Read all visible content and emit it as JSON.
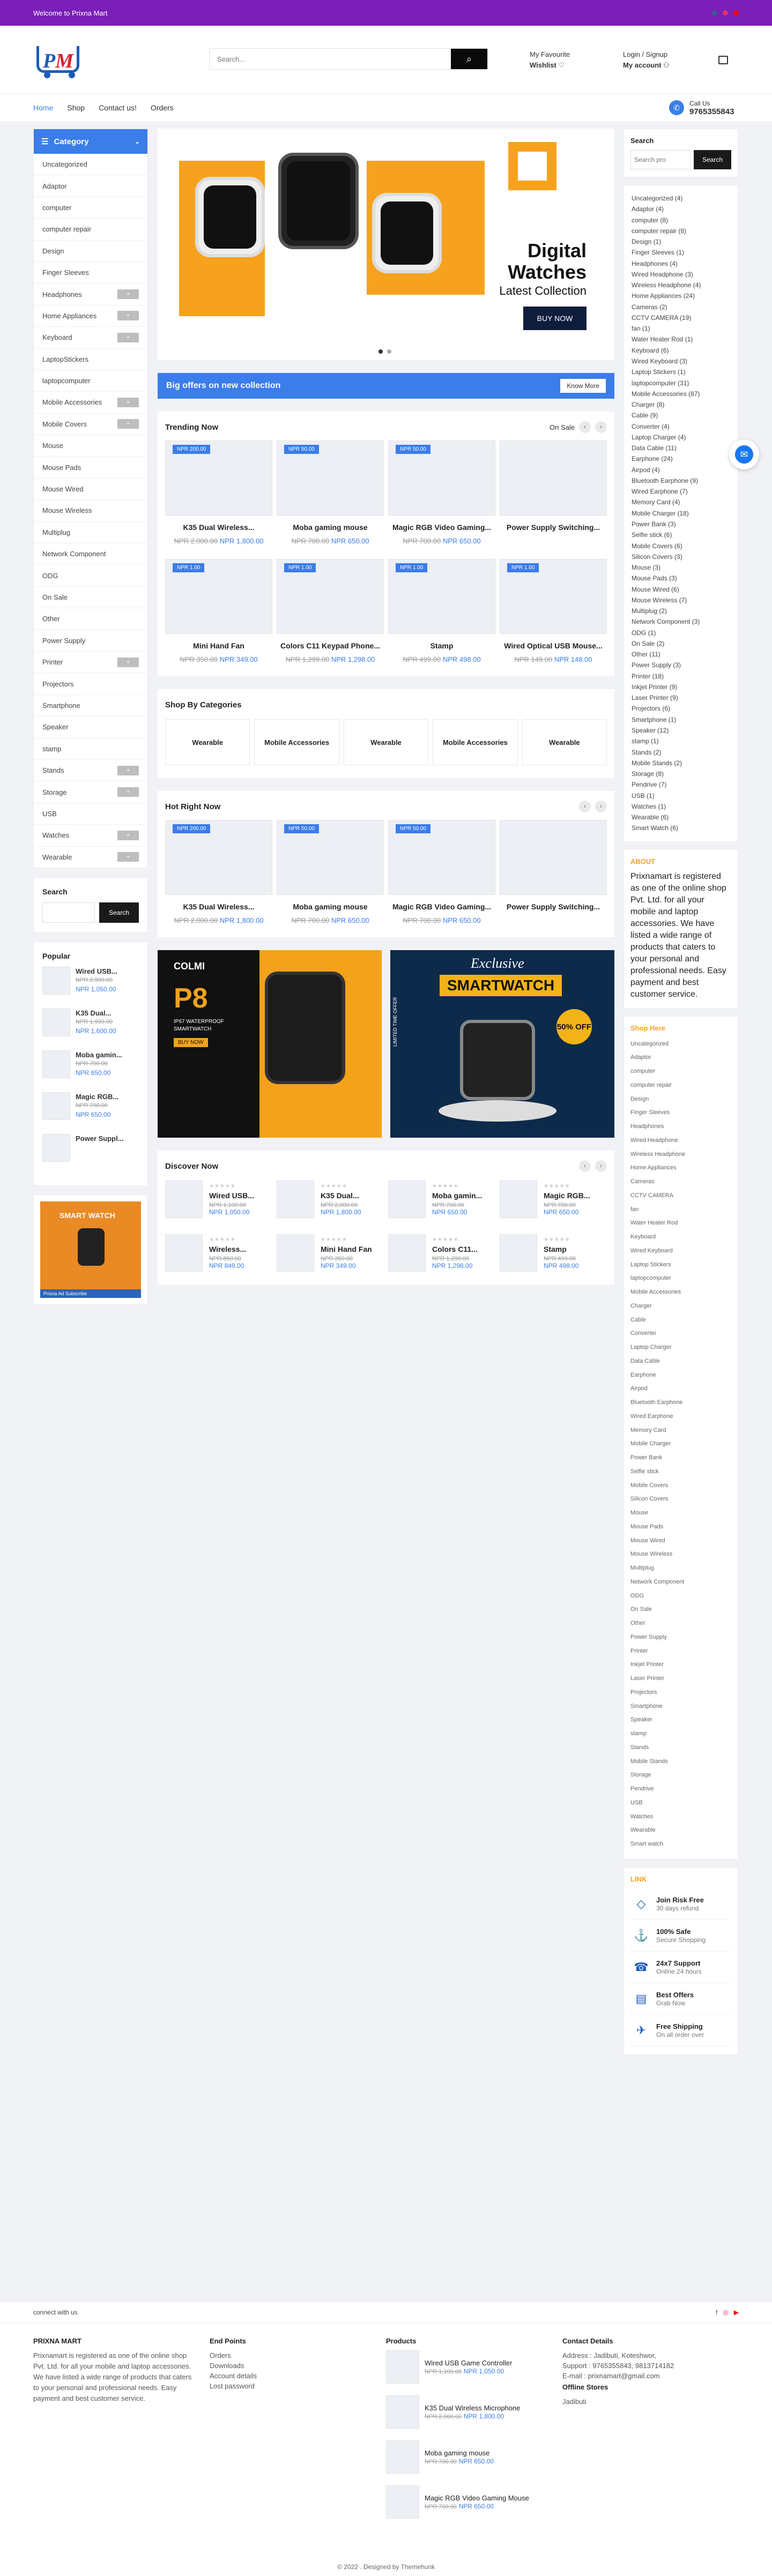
{
  "topbar": {
    "welcome": "Welcome to Prixna Mart",
    "social": [
      "#3b5998",
      "#e1306c",
      "#ff0000"
    ]
  },
  "header": {
    "logo": "PM",
    "search_placeholder": "Search...",
    "favourite_label": "My Favourite",
    "wishlist_label": "Wishlist",
    "login_label": "Login / Signup",
    "account_label": "My account"
  },
  "nav": {
    "links": [
      "Home",
      "Shop",
      "Contact us!",
      "Orders"
    ],
    "call_label": "Call Us",
    "phone": "9765355843"
  },
  "sidebar": {
    "title": "Category",
    "categories": [
      {
        "label": "Uncategorized",
        "expand": false
      },
      {
        "label": "Adaptor",
        "expand": false
      },
      {
        "label": "computer",
        "expand": false
      },
      {
        "label": "computer repair",
        "expand": false
      },
      {
        "label": "Design",
        "expand": false
      },
      {
        "label": "Finger Sleeves",
        "expand": false
      },
      {
        "label": "Headphones",
        "expand": true
      },
      {
        "label": "Home Appliances",
        "expand": true
      },
      {
        "label": "Keyboard",
        "expand": true
      },
      {
        "label": "LaptopStickers",
        "expand": false
      },
      {
        "label": "laptopcomputer",
        "expand": false
      },
      {
        "label": "Mobile Accessories",
        "expand": true
      },
      {
        "label": "Mobile Covers",
        "expand": true
      },
      {
        "label": "Mouse",
        "expand": false
      },
      {
        "label": "Mouse Pads",
        "expand": false
      },
      {
        "label": "Mouse Wired",
        "expand": false
      },
      {
        "label": "Mouse Wireless",
        "expand": false
      },
      {
        "label": "Multiplug",
        "expand": false
      },
      {
        "label": "Network Component",
        "expand": false
      },
      {
        "label": "ODG",
        "expand": false
      },
      {
        "label": "On Sale",
        "expand": false
      },
      {
        "label": "Other",
        "expand": false
      },
      {
        "label": "Power Supply",
        "expand": false
      },
      {
        "label": "Printer",
        "expand": true
      },
      {
        "label": "Projectors",
        "expand": false
      },
      {
        "label": "Smartphone",
        "expand": false
      },
      {
        "label": "Speaker",
        "expand": false
      },
      {
        "label": "stamp",
        "expand": false
      },
      {
        "label": "Stands",
        "expand": true
      },
      {
        "label": "Storage",
        "expand": true
      },
      {
        "label": "USB",
        "expand": false
      },
      {
        "label": "Watches",
        "expand": true
      },
      {
        "label": "Wearable",
        "expand": true
      }
    ],
    "expand_symbol": "+",
    "search_title": "Search",
    "search_button": "Search",
    "popular_title": "Popular",
    "popular": [
      {
        "name": "Wired USB...",
        "old": "NPR 2,999.00",
        "new": "NPR 1,050.00"
      },
      {
        "name": "K35 Dual...",
        "old": "NPR 1,999.00",
        "new": "NPR 1,600.00"
      },
      {
        "name": "Moba gamin...",
        "old": "NPR 790.00",
        "new": "NPR 650.00"
      },
      {
        "name": "Magic RGB...",
        "old": "NPR 790.00",
        "new": "NPR 650.00"
      },
      {
        "name": "Power Suppl...",
        "old": "",
        "new": ""
      }
    ],
    "promo_caption": "Prixna Ad Subscribe"
  },
  "hero": {
    "title_line1": "Digital",
    "title_line2": "Watches",
    "subtitle": "Latest Collection",
    "button": "BUY NOW"
  },
  "offer": {
    "text": "Big offers on new collection",
    "button": "Know More"
  },
  "trending": {
    "title": "Trending Now",
    "onsale": "On Sale",
    "products": [
      {
        "tag": "NPR 200.00",
        "name": "K35 Dual Wireless...",
        "old": "NPR 2,000.00",
        "new": "NPR 1,800.00"
      },
      {
        "tag": "NPR 50.00",
        "name": "Moba gaming mouse",
        "old": "NPR 700.00",
        "new": "NPR 650.00"
      },
      {
        "tag": "NPR 50.00",
        "name": "Magic RGB Video Gaming...",
        "old": "NPR 700.00",
        "new": "NPR 650.00"
      },
      {
        "tag": "",
        "name": "Power Supply Switching...",
        "old": "",
        "new": ""
      },
      {
        "tag": "NPR 1.00",
        "name": "Mini Hand Fan",
        "old": "NPR 350.00",
        "new": "NPR 349.00"
      },
      {
        "tag": "NPR 1.00",
        "name": "Colors C11 Keypad Phone...",
        "old": "NPR 1,299.00",
        "new": "NPR 1,298.00"
      },
      {
        "tag": "NPR 1.00",
        "name": "Stamp",
        "old": "NPR 499.00",
        "new": "NPR 498.00"
      },
      {
        "tag": "NPR 1.00",
        "name": "Wired Optical USB Mouse...",
        "old": "NPR 149.00",
        "new": "NPR 148.00"
      }
    ]
  },
  "categories": {
    "title": "Shop By Categories",
    "items": [
      "Wearable",
      "Mobile Accessories",
      "Wearable",
      "Mobile Accessories",
      "Wearable"
    ]
  },
  "hotright": {
    "title": "Hot Right Now",
    "products": [
      {
        "tag": "NPR 200.00",
        "name": "K35 Dual Wireless...",
        "old": "NPR 2,000.00",
        "new": "NPR 1,800.00"
      },
      {
        "tag": "NPR 50.00",
        "name": "Moba gaming mouse",
        "old": "NPR 700.00",
        "new": "NPR 650.00"
      },
      {
        "tag": "NPR 50.00",
        "name": "Magic RGB Video Gaming...",
        "old": "NPR 700.00",
        "new": "NPR 650.00"
      },
      {
        "tag": "",
        "name": "Power Supply Switching...",
        "old": "",
        "new": ""
      }
    ]
  },
  "banners": {
    "b1_brand": "COLMI",
    "b1_model": "P8",
    "b1_spec1": "IP67 WATERPROOF",
    "b1_spec2": "SMARTWATCH",
    "b1_badge": "BUY NOW",
    "b2_top": "Exclusive",
    "b2_title": "SMARTWATCH",
    "b2_badge": "50% OFF",
    "b2_side": "LIMITED TIME OFFER"
  },
  "discover": {
    "title": "Discover Now",
    "stars": "★★★★★",
    "items": [
      {
        "name": "Wired USB...",
        "old": "NPR 1,100.00",
        "new": "NPR 1,050.00"
      },
      {
        "name": "K35 Dual...",
        "old": "NPR 2,000.00",
        "new": "NPR 1,800.00"
      },
      {
        "name": "Moba gamin...",
        "old": "NPR 700.00",
        "new": "NPR 650.00"
      },
      {
        "name": "Magic RGB...",
        "old": "NPR 700.00",
        "new": "NPR 650.00"
      },
      {
        "name": "Wireless...",
        "old": "NPR 850.00",
        "new": "NPR 849.00"
      },
      {
        "name": "Mini Hand Fan",
        "old": "NPR 350.00",
        "new": "NPR 349.00"
      },
      {
        "name": "Colors C11...",
        "old": "NPR 1,299.00",
        "new": "NPR 1,298.00"
      },
      {
        "name": "Stamp",
        "old": "NPR 499.00",
        "new": "NPR 498.00"
      }
    ]
  },
  "right": {
    "search_title": "Search",
    "search_placeholder": "Search pro",
    "search_button": "Search",
    "cat_counts": [
      "Uncategorized (4)",
      "Adaptor (4)",
      "computer (8)",
      "computer repair (8)",
      "Design (1)",
      "Finger Sleeves (1)",
      "Headphones (4)",
      "Wired Headphone (3)",
      "Wireless Headphone (4)",
      "Home Appliances (24)",
      "Cameras (2)",
      "CCTV CAMERA (19)",
      "fan (1)",
      "Water Heater Rod (1)",
      "Keyboard (6)",
      "Wired Keyboard (3)",
      "Laptop Stickers (1)",
      "laptopcomputer (31)",
      "Mobile Accessories (87)",
      "Charger (8)",
      "Cable (9)",
      "Converter (4)",
      "Laptop Charger (4)",
      "Data Cable (11)",
      "Earphone (24)",
      "Airpod (4)",
      "Bluetooth Earphone (9)",
      "Wired Earphone (7)",
      "Memory Card (4)",
      "Mobile Charger (18)",
      "Power Bank (3)",
      "Selfie stick (6)",
      "Mobile Covers (6)",
      "Silicon Covers (3)",
      "Mouse (3)",
      "Mouse Pads (3)",
      "Mouse Wired (6)",
      "Mouse Wireless (7)",
      "Multiplug (2)",
      "Network Component (3)",
      "ODG (1)",
      "On Sale (2)",
      "Other (11)",
      "Power Supply (3)",
      "Printer (18)",
      "Inkjet Printer (9)",
      "Laser Printer (9)",
      "Projectors (6)",
      "Smartphone (1)",
      "Speaker (12)",
      "stamp (1)",
      "Stands (2)",
      "Mobile Stands (2)",
      "Storage (8)",
      "Pendrive (7)",
      "USB (1)",
      "Watches (1)",
      "Wearable (6)",
      "Smart Watch (6)"
    ],
    "about_title": "ABOUT",
    "about_text": "Prixnamart is registered as one of the online shop Pvt. Ltd. for all your mobile and laptop accessories. We have listed a wide range of products that caters to your personal and professional needs. Easy payment and best customer service.",
    "shophere_title": "Shop Here",
    "shop_list": [
      "Uncategorized",
      "Adaptor",
      "computer",
      "computer repair",
      "Design",
      "Finger Sleeves",
      "Headphones",
      "Wired Headphone",
      "Wireless Headphone",
      "Home Appliances",
      "Cameras",
      "CCTV CAMERA",
      "fan",
      "Water Heater Rod",
      "Keyboard",
      "Wired Keyboard",
      "Laptop Stickers",
      "laptopcomputer",
      "Mobile Accessories",
      "Charger",
      "Cable",
      "Converter",
      "Laptop Charger",
      "Data Cable",
      "Earphone",
      "Airpod",
      "Bluetooth Earphone",
      "Wired Earphone",
      "Memory Card",
      "Mobile Charger",
      "Power Bank",
      "Selfie stick",
      "Mobile Covers",
      "Silicon Covers",
      "Mouse",
      "Mouse Pads",
      "Mouse Wired",
      "Mouse Wireless",
      "Multiplug",
      "Network Component",
      "ODG",
      "On Sale",
      "Other",
      "Power Supply",
      "Printer",
      "Inkjet Printer",
      "Laser Printer",
      "Projectors",
      "Smartphone",
      "Speaker",
      "stamp",
      "Stands",
      "Mobile Stands",
      "Storage",
      "Pendrive",
      "USB",
      "Watches",
      "Wearable",
      "Smart watch"
    ],
    "link_title": "LINK",
    "guarantees": [
      {
        "icon": "◇",
        "title": "Join Risk Free",
        "sub": "30 days refund"
      },
      {
        "icon": "⚓",
        "title": "100% Safe",
        "sub": "Secure Shopping"
      },
      {
        "icon": "☎",
        "title": "24x7 Support",
        "sub": "Online 24 hours"
      },
      {
        "icon": "▤",
        "title": "Best Offers",
        "sub": "Grab Now"
      },
      {
        "icon": "✈",
        "title": "Free Shipping",
        "sub": "On all order over"
      }
    ]
  },
  "footer": {
    "connect": "connect with us",
    "brand": "PRIXNA MART",
    "about": "Prixnamart is registered as one of the online shop Pvt. Ltd. for all your mobile and laptop accessories. We have listed a wide range of products that caters to your personal and professional needs. Easy payment and best customer service.",
    "endpoints_title": "End Points",
    "endpoints": [
      "Orders",
      "Downloads",
      "Account details",
      "Lost password"
    ],
    "products_title": "Products",
    "products": [
      {
        "name": "Wired USB Game Controller",
        "old": "NPR 1,100.00",
        "new": "NPR 1,050.00"
      },
      {
        "name": "K35 Dual Wireless Microphone",
        "old": "NPR 2,000.00",
        "new": "NPR 1,800.00"
      },
      {
        "name": "Moba gaming mouse",
        "old": "NPR 700.00",
        "new": "NPR 650.00"
      },
      {
        "name": "Magic RGB Video Gaming Mouse",
        "old": "NPR 700.00",
        "new": "NPR 650.00"
      }
    ],
    "contact_title": "Contact Details",
    "contact_lines": [
      "Address : Jadibuti, Koteshwor,",
      "Support : 9765355843, 9813714182",
      "E-mail : prixnamart@gmail.com"
    ],
    "offline_title": "Offline Stores",
    "offline": "Jadibuti",
    "copyright": "© 2022 . Designed by Themehunk"
  }
}
